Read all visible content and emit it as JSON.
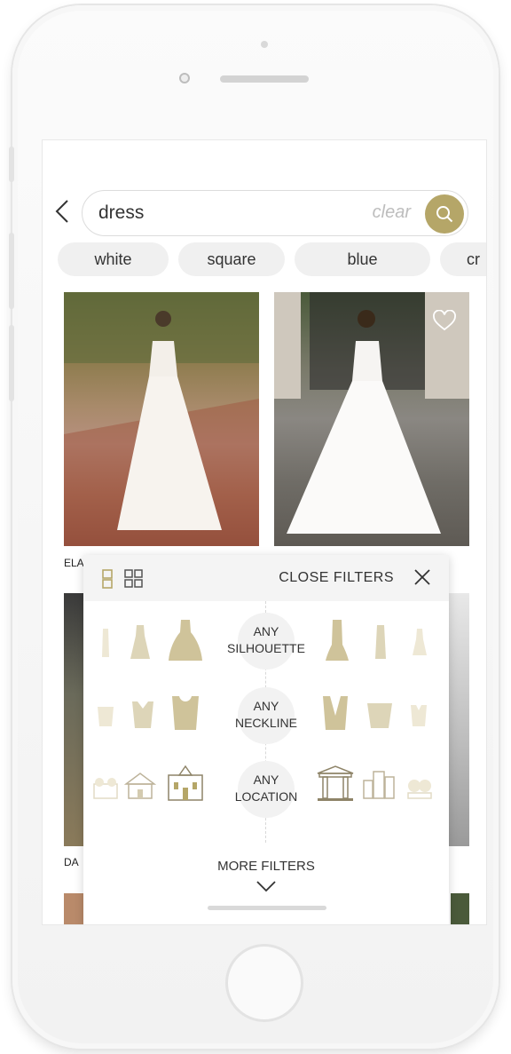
{
  "search": {
    "query": "dress",
    "clear_label": "clear"
  },
  "chips": [
    "white",
    "square",
    "blue",
    "cr"
  ],
  "results": {
    "item1_caption": "ELA",
    "item2_caption": "DA"
  },
  "filters": {
    "close_label": "CLOSE FILTERS",
    "silhouette": {
      "any": "ANY",
      "label": "SILHOUETTE"
    },
    "neckline": {
      "any": "ANY",
      "label": "NECKLINE"
    },
    "location": {
      "any": "ANY",
      "label": "LOCATION"
    },
    "more_label": "MORE FILTERS"
  },
  "colors": {
    "accent_gold": "#b5a668",
    "icon_beige_dark": "#cfc39a",
    "icon_beige_light": "#e8e1c9"
  },
  "icons": [
    "back-chevron-icon",
    "search-icon",
    "heart-icon",
    "single-view-icon",
    "grid-view-icon",
    "close-icon",
    "chevron-down-icon"
  ]
}
